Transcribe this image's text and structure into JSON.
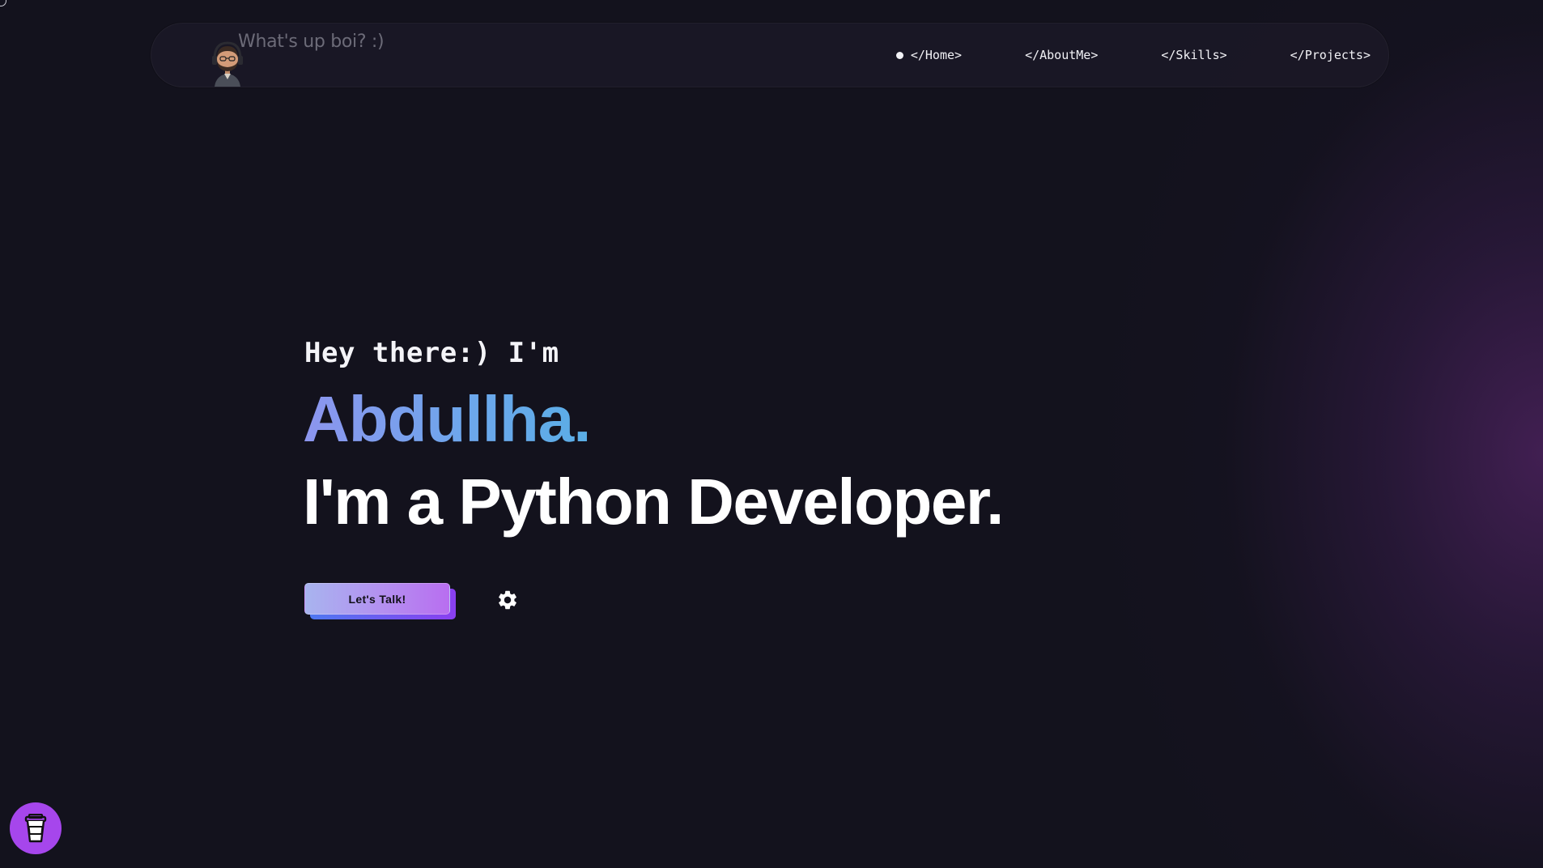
{
  "navbar": {
    "greeting": "What's up boi? :)",
    "links": [
      {
        "label": "</Home>",
        "active": true
      },
      {
        "label": "</AboutMe>",
        "active": false
      },
      {
        "label": "</Skills>",
        "active": false
      },
      {
        "label": "</Projects>",
        "active": false
      }
    ]
  },
  "hero": {
    "intro": "Hey there:) I'm",
    "name": "Abdullha.",
    "role": "I'm a Python Developer.",
    "cta_label": "Let's Talk!"
  },
  "icons": {
    "avatar": "avatar-memoji",
    "settings": "gear-icon",
    "floating": "coffee-cup-icon"
  },
  "colors": {
    "background": "#13121d",
    "accent_purple": "#a646ec",
    "name_gradient_start": "#8d95ee",
    "name_gradient_end": "#5aaee6",
    "text": "#ffffff"
  }
}
